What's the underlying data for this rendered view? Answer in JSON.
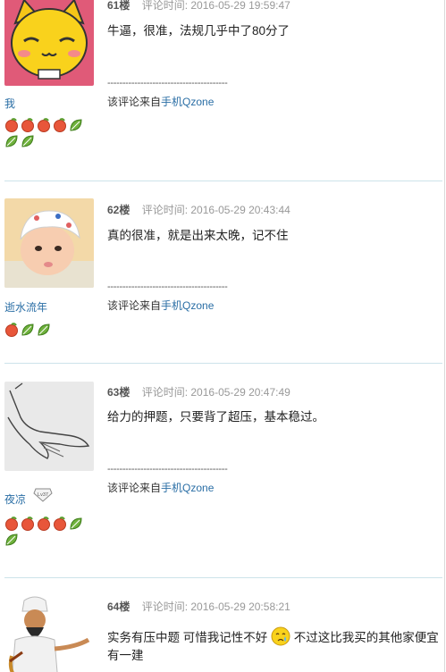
{
  "comments": [
    {
      "floor": "61楼",
      "time": "评论时间: 2016-05-29 19:59:47",
      "text": "牛逼，很准，法规几乎中了80分了",
      "username": "我",
      "avatar_icon": "yellow-cat-cartoon",
      "medals": [
        "peach",
        "peach",
        "peach",
        "peach",
        "leaf",
        "leaf",
        "leaf"
      ],
      "divider": "----------------------------------------",
      "source_prefix": "该评论来自",
      "source_link": "手机Qzone"
    },
    {
      "floor": "62楼",
      "time": "评论时间: 2016-05-29 20:43:44",
      "text": "真的很准，就是出来太晚，记不住",
      "username": "逝水流年",
      "avatar_icon": "baby-photo",
      "medals": [
        "peach",
        "leaf",
        "leaf"
      ],
      "divider": "----------------------------------------",
      "source_prefix": "该评论来自",
      "source_link": "手机Qzone"
    },
    {
      "floor": "63楼",
      "time": "评论时间: 2016-05-29 20:47:49",
      "text": "给力的押题，只要背了超压，基本稳过。",
      "username": "夜凉",
      "badge_text": "Lv37",
      "avatar_icon": "hand-sketch",
      "medals": [
        "peach",
        "peach",
        "peach",
        "peach",
        "leaf",
        "leaf"
      ],
      "divider": "----------------------------------------",
      "source_prefix": "该评论来自",
      "source_link": "手机Qzone"
    },
    {
      "floor": "64楼",
      "time": "评论时间: 2016-05-29 20:58:21",
      "text_part1": "实务有压中题 可惜我记性不好",
      "emoji_icon": "crying-face-emoji",
      "text_part2": " 不过这比我买的其他家便宜",
      "text_line2": "有一建",
      "avatar_icon": "genie-cartoon"
    }
  ],
  "colors": {
    "separator": "#cde3ea",
    "link": "#2a6ea5",
    "time": "#999999",
    "peach": "#e8563a",
    "leaf": "#6fb13c"
  }
}
